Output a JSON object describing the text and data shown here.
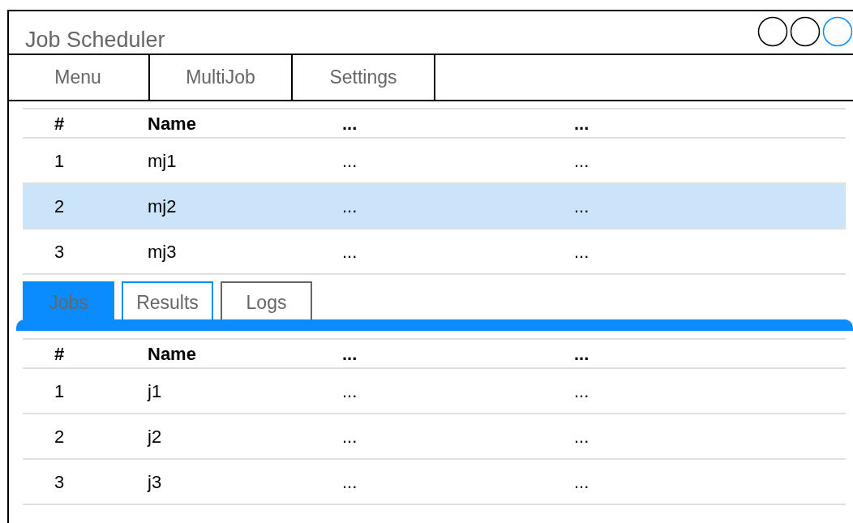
{
  "window": {
    "title": "Job Scheduler"
  },
  "window_buttons": [
    {
      "selected": false
    },
    {
      "selected": false
    },
    {
      "selected": true
    }
  ],
  "menu_tabs": [
    "Menu",
    "MultiJob",
    "Settings"
  ],
  "multijobs": {
    "columns": [
      "#",
      "Name",
      "...",
      "..."
    ],
    "rows": [
      {
        "cells": [
          "1",
          "mj1",
          "...",
          "..."
        ],
        "selected": false
      },
      {
        "cells": [
          "2",
          "mj2",
          "...",
          "..."
        ],
        "selected": true
      },
      {
        "cells": [
          "3",
          "mj3",
          "...",
          "..."
        ],
        "selected": false
      }
    ]
  },
  "detail_tabs": [
    {
      "label": "Jobs",
      "selected": true,
      "focused": false
    },
    {
      "label": "Results",
      "selected": false,
      "focused": true
    },
    {
      "label": "Logs",
      "selected": false,
      "focused": false
    }
  ],
  "jobs": {
    "columns": [
      "#",
      "Name",
      "...",
      "..."
    ],
    "rows": [
      {
        "cells": [
          "1",
          "j1",
          "...",
          "..."
        ],
        "selected": false
      },
      {
        "cells": [
          "2",
          "j2",
          "...",
          "..."
        ],
        "selected": false
      },
      {
        "cells": [
          "3",
          "j3",
          "...",
          "..."
        ],
        "selected": false
      }
    ]
  }
}
